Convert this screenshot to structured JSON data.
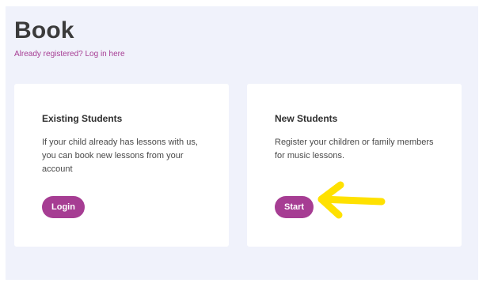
{
  "page": {
    "title": "Book",
    "login_link": "Already registered? Log in here"
  },
  "cards": [
    {
      "title": "Existing Students",
      "description": "If your child already has lessons with us, you can book new lessons from your account",
      "button_label": "Login"
    },
    {
      "title": "New Students",
      "description": "Register your children or family members for music lessons.",
      "button_label": "Start"
    }
  ],
  "annotation": {
    "arrow_color": "#ffe100",
    "points_to": "start-button"
  },
  "colors": {
    "accent": "#a63d93",
    "panel_background": "#f0f2fb"
  }
}
